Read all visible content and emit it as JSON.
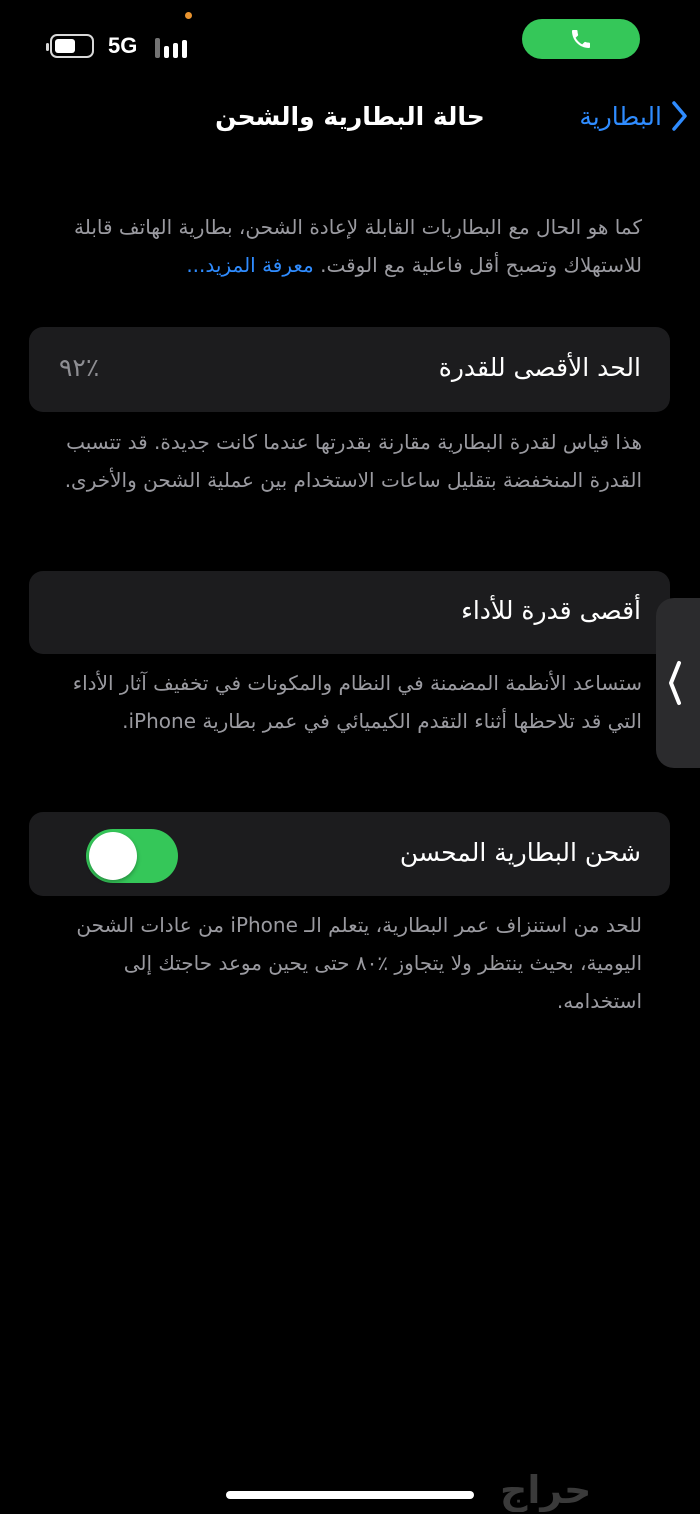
{
  "status_bar": {
    "network": "5G",
    "battery_level": 0.45,
    "call_active_color": "#35c759"
  },
  "nav": {
    "back_label": "البطارية",
    "title": "حالة البطارية والشحن"
  },
  "intro": {
    "text": "كما هو الحال مع البطاريات القابلة لإعادة الشحن، بطارية الهاتف قابلة للاستهلاك وتصبح أقل فاعلية مع الوقت.",
    "link": "معرفة المزيد..."
  },
  "max_capacity": {
    "label": "الحد الأقصى للقدرة",
    "value": "٪٩٢",
    "description": "هذا قياس لقدرة البطارية مقارنة بقدرتها عندما كانت جديدة. قد تتسبب القدرة المنخفضة بتقليل ساعات الاستخدام بين عملية الشحن والأخرى."
  },
  "peak_performance": {
    "label": "أقصى قدرة للأداء",
    "description": "ستساعد الأنظمة المضمنة في النظام والمكونات في تخفيف آثار الأداء التي قد تلاحظها أثناء التقدم الكيميائي في عمر بطارية iPhone."
  },
  "optimized_charging": {
    "label": "شحن البطارية المحسن",
    "enabled": true,
    "description": "للحد من استنزاف عمر البطارية، يتعلم الـ iPhone من عادات الشحن اليومية، بحيث ينتظر ولا يتجاوز ٪٨٠ حتى يحين موعد حاجتك إلى استخدامه."
  },
  "watermark": "حراج",
  "colors": {
    "accent": "#2f8cff",
    "toggle_on": "#35c759",
    "card_bg": "#1c1c1e",
    "secondary_text": "#9a9aa0"
  }
}
